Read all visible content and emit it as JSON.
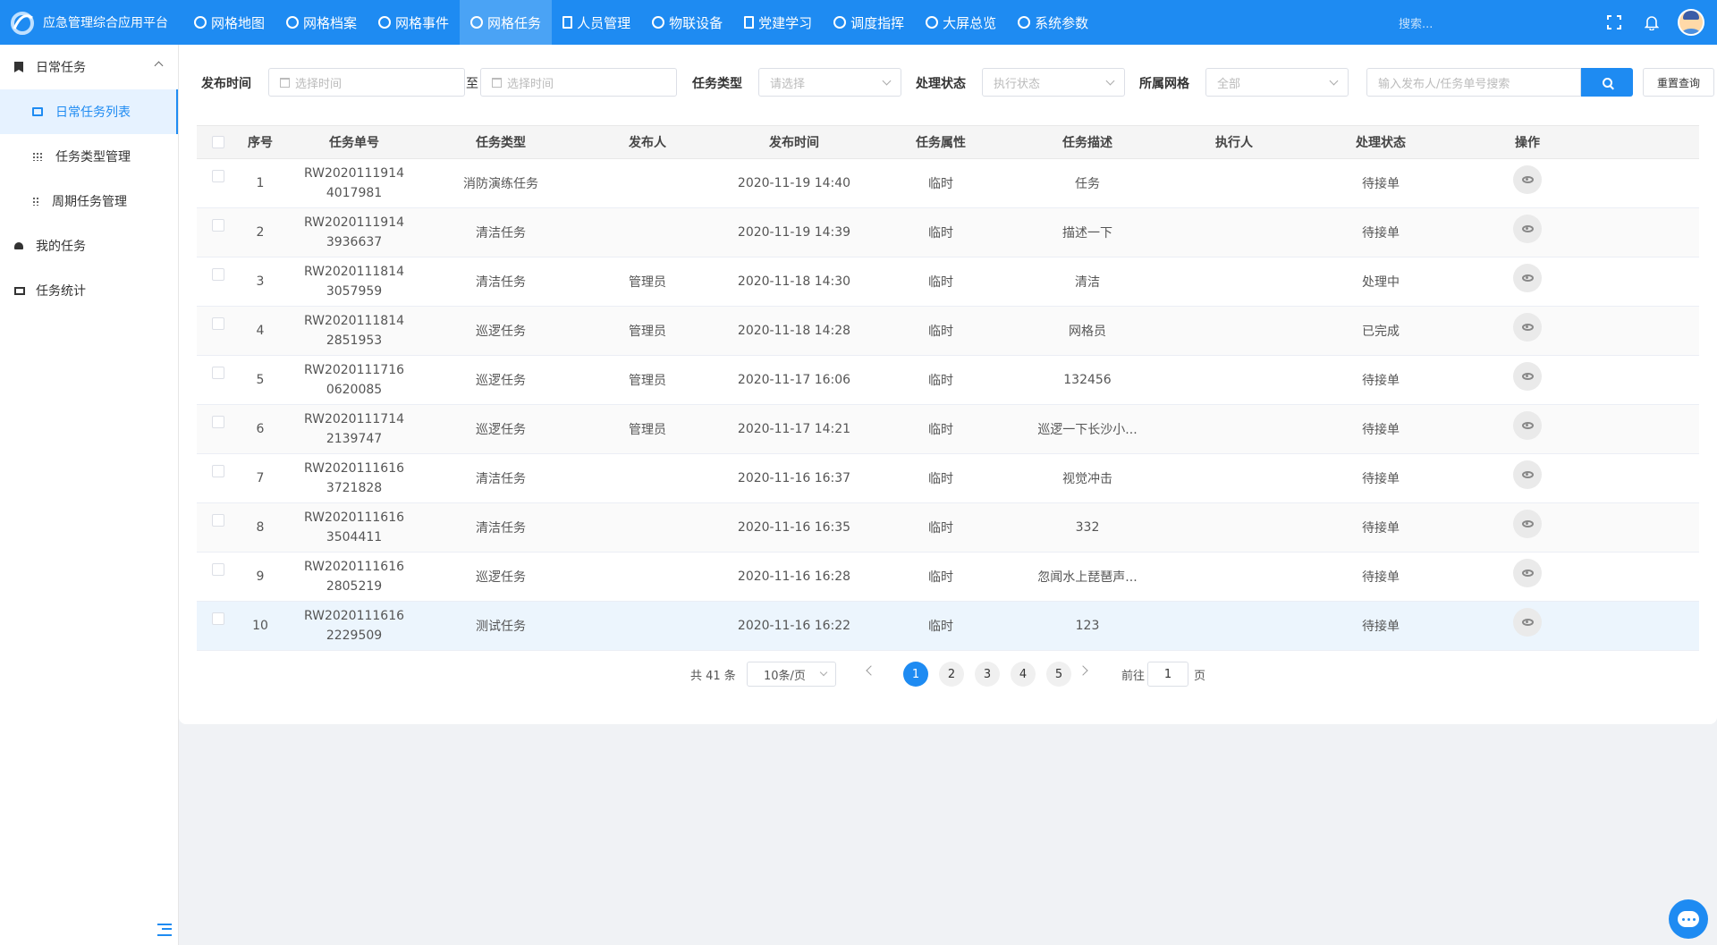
{
  "app": {
    "title": "应急管理综合应用平台"
  },
  "nav": [
    {
      "label": "网格地图"
    },
    {
      "label": "网格档案"
    },
    {
      "label": "网格事件"
    },
    {
      "label": "网格任务",
      "active": true
    },
    {
      "label": "人员管理"
    },
    {
      "label": "物联设备"
    },
    {
      "label": "党建学习"
    },
    {
      "label": "调度指挥"
    },
    {
      "label": "大屏总览"
    },
    {
      "label": "系统参数"
    }
  ],
  "header": {
    "search_placeholder": "搜索..."
  },
  "sidebar": {
    "group": "日常任务",
    "subs": [
      "日常任务列表",
      "任务类型管理",
      "周期任务管理"
    ],
    "items": [
      "我的任务",
      "任务统计"
    ]
  },
  "filters": {
    "publish_time_label": "发布时间",
    "start_placeholder": "选择时间",
    "to": "至",
    "end_placeholder": "选择时间",
    "task_type_label": "任务类型",
    "task_type_placeholder": "请选择",
    "status_label": "处理状态",
    "status_placeholder": "执行状态",
    "grid_label": "所属网格",
    "grid_value": "全部",
    "search_placeholder": "输入发布人/任务单号搜索",
    "reset_label": "重置查询"
  },
  "table": {
    "columns": [
      "序号",
      "任务单号",
      "任务类型",
      "发布人",
      "发布时间",
      "任务属性",
      "任务描述",
      "执行人",
      "处理状态",
      "操作"
    ],
    "rows": [
      {
        "no": "1",
        "code": "RW20201119144017981",
        "type": "消防演练任务",
        "publisher": "",
        "time": "2020-11-19 14:40",
        "attr": "临时",
        "desc": "任务",
        "executor": "",
        "status": "待接单"
      },
      {
        "no": "2",
        "code": "RW20201119143936637",
        "type": "清洁任务",
        "publisher": "",
        "time": "2020-11-19 14:39",
        "attr": "临时",
        "desc": "描述一下",
        "executor": "",
        "status": "待接单"
      },
      {
        "no": "3",
        "code": "RW20201118143057959",
        "type": "清洁任务",
        "publisher": "管理员",
        "time": "2020-11-18 14:30",
        "attr": "临时",
        "desc": "清洁",
        "executor": "",
        "status": "处理中"
      },
      {
        "no": "4",
        "code": "RW20201118142851953",
        "type": "巡逻任务",
        "publisher": "管理员",
        "time": "2020-11-18 14:28",
        "attr": "临时",
        "desc": "网格员",
        "executor": "",
        "status": "已完成"
      },
      {
        "no": "5",
        "code": "RW20201117160620085",
        "type": "巡逻任务",
        "publisher": "管理员",
        "time": "2020-11-17 16:06",
        "attr": "临时",
        "desc": "132456",
        "executor": "",
        "status": "待接单"
      },
      {
        "no": "6",
        "code": "RW20201117142139747",
        "type": "巡逻任务",
        "publisher": "管理员",
        "time": "2020-11-17 14:21",
        "attr": "临时",
        "desc": "巡逻一下长沙小...",
        "executor": "",
        "status": "待接单"
      },
      {
        "no": "7",
        "code": "RW20201116163721828",
        "type": "清洁任务",
        "publisher": "",
        "time": "2020-11-16 16:37",
        "attr": "临时",
        "desc": "视觉冲击",
        "executor": "",
        "status": "待接单"
      },
      {
        "no": "8",
        "code": "RW20201116163504411",
        "type": "清洁任务",
        "publisher": "",
        "time": "2020-11-16 16:35",
        "attr": "临时",
        "desc": "332",
        "executor": "",
        "status": "待接单"
      },
      {
        "no": "9",
        "code": "RW20201116162805219",
        "type": "巡逻任务",
        "publisher": "",
        "time": "2020-11-16 16:28",
        "attr": "临时",
        "desc": "忽闻水上琵琶声...",
        "executor": "",
        "status": "待接单"
      },
      {
        "no": "10",
        "code": "RW20201116162229509",
        "type": "测试任务",
        "publisher": "",
        "time": "2020-11-16 16:22",
        "attr": "临时",
        "desc": "123",
        "executor": "",
        "status": "待接单"
      }
    ]
  },
  "pagination": {
    "total": "共 41 条",
    "page_size": "10条/页",
    "pages": [
      "1",
      "2",
      "3",
      "4",
      "5"
    ],
    "goto_prefix": "前往",
    "goto_value": "1",
    "goto_suffix": "页"
  },
  "colors": {
    "brand": "#1e8bf2",
    "nav_active": "#4aa3f5",
    "row_highlight": "#ecf5fd"
  }
}
